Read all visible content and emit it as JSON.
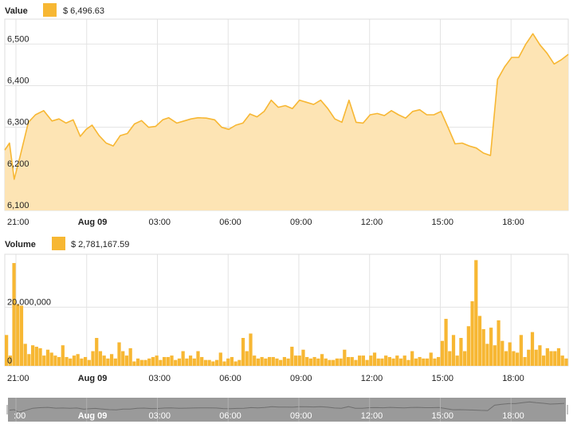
{
  "colors": {
    "accent": "#f7b733",
    "area_fill": "#fde4b4",
    "grid": "#e3e3e3",
    "navigator_bg": "#9a9a9a",
    "navigator_handle": "#ffffff"
  },
  "value_panel": {
    "legend_label": "Value",
    "legend_value": "$ 6,496.63"
  },
  "volume_panel": {
    "legend_label": "Volume",
    "legend_value": "$ 2,781,167.59"
  },
  "navigator": {
    "x_tick_labels": [
      ":00",
      "Aug 09",
      "03:00",
      "06:00",
      "09:00",
      "12:00",
      "15:00",
      "18:00"
    ]
  },
  "chart_data": [
    {
      "type": "area",
      "name": "Value",
      "x_tick_labels": [
        "21:00",
        "Aug 09",
        "03:00",
        "06:00",
        "09:00",
        "12:00",
        "15:00",
        "18:00"
      ],
      "x_tick_hours": [
        0,
        3,
        6,
        9,
        12,
        15,
        18,
        21
      ],
      "x_range_hours": [
        0,
        23.9
      ],
      "ylim": [
        6100,
        6560
      ],
      "y_ticks": [
        6100,
        6200,
        6300,
        6400,
        6500
      ],
      "y_tick_labels": [
        "6,100",
        "6,200",
        "6,300",
        "6,400",
        "6,500"
      ],
      "grid": true,
      "x": [
        0,
        0.2,
        0.4,
        0.65,
        1.0,
        1.3,
        1.65,
        2.0,
        2.3,
        2.6,
        2.9,
        3.2,
        3.45,
        3.7,
        4.0,
        4.3,
        4.6,
        4.9,
        5.2,
        5.5,
        5.8,
        6.1,
        6.4,
        6.7,
        6.95,
        7.3,
        7.6,
        7.9,
        8.2,
        8.55,
        8.9,
        9.2,
        9.5,
        9.8,
        10.1,
        10.4,
        10.7,
        11.0,
        11.3,
        11.6,
        11.9,
        12.2,
        12.5,
        12.8,
        13.1,
        13.4,
        13.7,
        14.0,
        14.3,
        14.6,
        14.9,
        15.2,
        15.5,
        15.8,
        16.1,
        16.4,
        16.7,
        17.0,
        17.3,
        17.6,
        17.9,
        18.2,
        18.5,
        18.8,
        19.1,
        19.4,
        19.7,
        20.0,
        20.3,
        20.6,
        20.9,
        21.2,
        21.5,
        21.8,
        22.1,
        22.4,
        22.7,
        23.0,
        23.3,
        23.6,
        23.9
      ],
      "y": [
        6245,
        6262,
        6175,
        6230,
        6312,
        6330,
        6340,
        6315,
        6320,
        6310,
        6318,
        6278,
        6295,
        6305,
        6280,
        6262,
        6255,
        6280,
        6285,
        6308,
        6316,
        6300,
        6302,
        6318,
        6323,
        6310,
        6315,
        6320,
        6323,
        6322,
        6318,
        6300,
        6295,
        6305,
        6310,
        6332,
        6325,
        6338,
        6365,
        6348,
        6352,
        6345,
        6365,
        6360,
        6355,
        6365,
        6345,
        6320,
        6312,
        6365,
        6312,
        6310,
        6330,
        6333,
        6328,
        6340,
        6330,
        6322,
        6338,
        6342,
        6330,
        6330,
        6338,
        6300,
        6260,
        6262,
        6255,
        6250,
        6238,
        6232,
        6415,
        6445,
        6468,
        6468,
        6500,
        6525,
        6498,
        6478,
        6452,
        6462,
        6475,
        6480,
        6468,
        6462,
        6480,
        6488,
        6497
      ]
    },
    {
      "type": "bar",
      "name": "Volume",
      "x_tick_labels": [
        "21:00",
        "Aug 09",
        "03:00",
        "06:00",
        "09:00",
        "12:00",
        "15:00",
        "18:00"
      ],
      "x_tick_hours": [
        0,
        3,
        6,
        9,
        12,
        15,
        18,
        21
      ],
      "x_range_hours": [
        0,
        23.9
      ],
      "ylim": [
        0,
        38000000
      ],
      "y_ticks": [
        0,
        20000000
      ],
      "y_tick_labels": [
        "0",
        "20,000,000"
      ],
      "grid": true,
      "bar_width_hours": 0.2,
      "values": [
        10500000,
        3500000,
        35000000,
        21000000,
        20500000,
        7500000,
        4000000,
        7000000,
        6500000,
        6000000,
        3500000,
        5500000,
        4500000,
        3500000,
        3000000,
        7000000,
        3000000,
        2500000,
        3500000,
        4000000,
        2500000,
        3000000,
        2000000,
        5000000,
        9500000,
        5000000,
        3500000,
        2500000,
        4000000,
        2500000,
        8000000,
        5000000,
        3500000,
        6000000,
        1500000,
        2500000,
        2000000,
        2000000,
        2500000,
        3000000,
        3500000,
        2000000,
        3000000,
        3000000,
        3500000,
        2000000,
        2500000,
        5000000,
        2500000,
        3500000,
        2500000,
        5000000,
        3000000,
        2000000,
        2000000,
        1500000,
        2000000,
        4500000,
        1500000,
        2500000,
        3000000,
        1500000,
        2000000,
        9500000,
        5000000,
        11000000,
        3500000,
        2500000,
        3000000,
        2500000,
        3000000,
        3000000,
        2500000,
        2000000,
        3000000,
        2500000,
        6500000,
        3500000,
        3500000,
        5500000,
        3000000,
        2500000,
        3000000,
        2500000,
        4000000,
        2500000,
        2000000,
        2000000,
        2500000,
        2500000,
        5500000,
        3000000,
        3000000,
        2000000,
        3500000,
        3500000,
        2000000,
        3500000,
        4500000,
        2500000,
        2500000,
        3500000,
        3000000,
        2500000,
        3500000,
        2500000,
        3500000,
        2000000,
        5000000,
        2500000,
        3000000,
        2500000,
        2500000,
        4500000,
        2500000,
        3000000,
        8500000,
        16000000,
        5000000,
        10500000,
        3500000,
        9500000,
        5000000,
        13500000,
        22000000,
        36000000,
        17000000,
        12500000,
        7500000,
        13000000,
        7000000,
        15500000,
        8500000,
        5000000,
        8000000,
        5000000,
        4500000,
        10500000,
        3000000,
        5500000,
        11500000,
        5500000,
        7000000,
        3500000,
        6000000,
        5000000,
        5000000,
        6000000,
        3500000,
        2500000
      ]
    }
  ]
}
